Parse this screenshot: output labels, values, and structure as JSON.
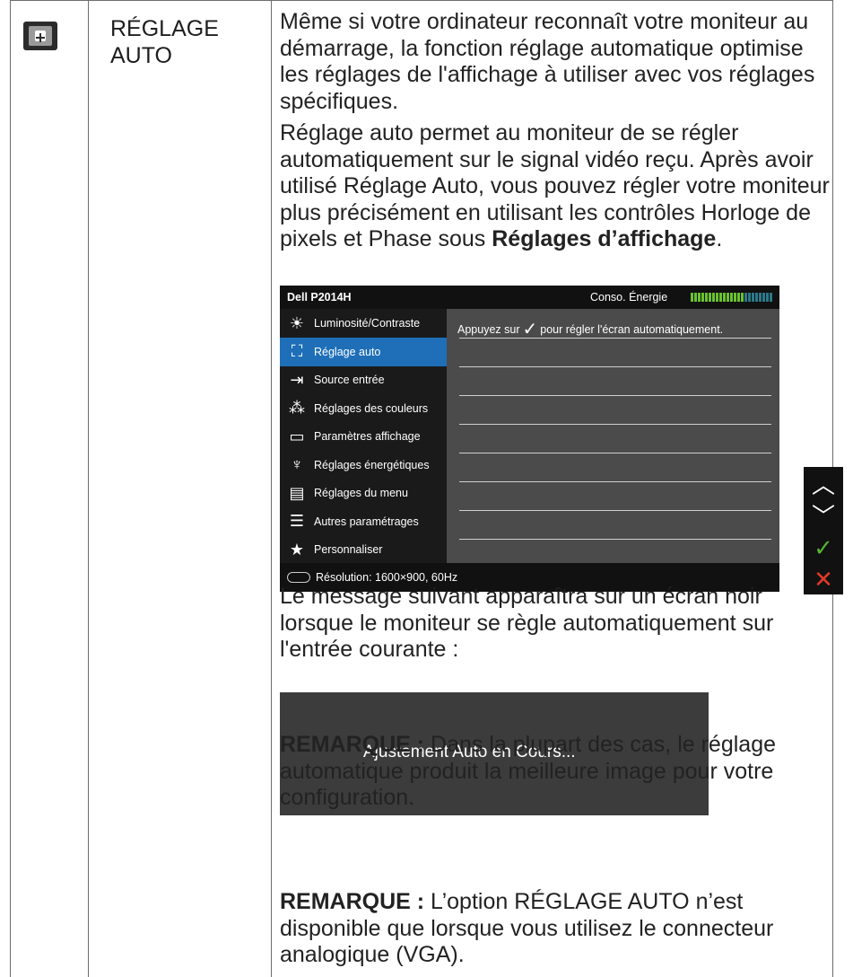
{
  "title": "RÉGLAGE AUTO",
  "para1": "Même si votre ordinateur reconnaît votre moniteur au démarrage, la fonction réglage automatique optimise les réglages de l'affichage à utiliser avec vos réglages spécifiques.",
  "para2_start": "Réglage auto permet au moniteur de se régler automatiquement sur le signal vidéo reçu. Après avoir utilisé Réglage Auto, vous pouvez régler votre moniteur plus précisément en utilisant les contrôles Horloge de pixels et Phase sous ",
  "para2_bold": "Réglages d’affichage",
  "para2_end": ".",
  "osd": {
    "model": "Dell P2014H",
    "energy_label": "Conso. Énergie",
    "energy_level": 0.65,
    "hint_before": "Appuyez sur",
    "hint_after": "pour régler l'écran automatiquement.",
    "resolution": "Résolution:  1600×900, 60Hz",
    "menu": [
      {
        "label": "Luminosité/Contraste",
        "icon": "brightness-icon",
        "glyph": "☀"
      },
      {
        "label": "Réglage auto",
        "icon": "auto-adjust-icon",
        "glyph": "⛶"
      },
      {
        "label": "Source entrée",
        "icon": "input-source-icon",
        "glyph": "⇥"
      },
      {
        "label": "Réglages des couleurs",
        "icon": "color-dots-icon",
        "glyph": "⁂"
      },
      {
        "label": "Paramètres affichage",
        "icon": "display-icon",
        "glyph": "▭"
      },
      {
        "label": "Réglages énergétiques",
        "icon": "energy-leaf-icon",
        "glyph": "♆"
      },
      {
        "label": "Réglages du menu",
        "icon": "menu-icon",
        "glyph": "▤"
      },
      {
        "label": "Autres paramétrages",
        "icon": "sliders-icon",
        "glyph": "☰"
      },
      {
        "label": "Personnaliser",
        "icon": "star-icon",
        "glyph": "★"
      }
    ],
    "selected_index": 1
  },
  "keys": {
    "up": "︿",
    "down": "﹀",
    "ok": "✓",
    "exit": "✕"
  },
  "para3": "Le message suivant apparaîtra sur un écran noir lorsque le moniteur se règle automatiquement sur l'entrée courante :",
  "message": "Ajustement Auto en Cours...",
  "note1_label": "REMARQUE :",
  "note1_text": " Dans la plupart des cas, le réglage automatique produit la meilleure image pour votre configuration.",
  "note2_label": "REMARQUE :",
  "note2_text": " L’option RÉGLAGE AUTO n’est disponible que lorsque vous utilisez le connecteur analogique (VGA)."
}
